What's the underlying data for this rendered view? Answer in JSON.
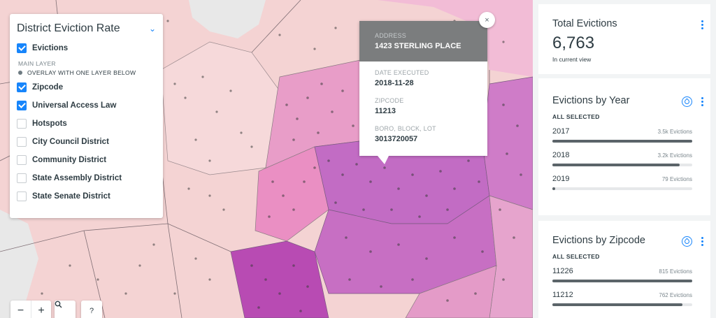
{
  "layers_panel": {
    "title": "District Eviction Rate",
    "layers": [
      {
        "label": "Evictions",
        "checked": true
      },
      {
        "label": "Zipcode",
        "checked": true
      },
      {
        "label": "Universal Access Law",
        "checked": true
      },
      {
        "label": "Hotspots",
        "checked": false
      },
      {
        "label": "City Council District",
        "checked": false
      },
      {
        "label": "Community District",
        "checked": false
      },
      {
        "label": "State Assembly District",
        "checked": false
      },
      {
        "label": "State Senate District",
        "checked": false
      }
    ],
    "main_layer_label": "MAIN LAYER",
    "overlay_label": "OVERLAY WITH ONE LAYER BELOW"
  },
  "popup": {
    "address_label": "ADDRESS",
    "address": "1423 STERLING PLACE",
    "date_label": "DATE EXECUTED",
    "date": "2018-11-28",
    "zip_label": "ZIPCODE",
    "zip": "11213",
    "bbl_label": "BORO, BLOCK, LOT",
    "bbl": "3013720057",
    "close_glyph": "×"
  },
  "map_controls": {
    "zoom_out": "−",
    "zoom_in": "+",
    "search_glyph": "🔍",
    "help": "?"
  },
  "widgets": {
    "total": {
      "title": "Total Evictions",
      "value": "6,763",
      "caption": "In current view"
    },
    "by_year": {
      "title": "Evictions by Year",
      "selection": "ALL SELECTED",
      "rows": [
        {
          "category": "2017",
          "count": "3.5k Evictions",
          "fraction": 1.0
        },
        {
          "category": "2018",
          "count": "3.2k Evictions",
          "fraction": 0.91
        },
        {
          "category": "2019",
          "count": "79 Evictions",
          "fraction": 0.02
        }
      ]
    },
    "by_zip": {
      "title": "Evictions by Zipcode",
      "selection": "ALL SELECTED",
      "rows": [
        {
          "category": "11226",
          "count": "815 Evictions",
          "fraction": 1.0
        },
        {
          "category": "11212",
          "count": "762 Evictions",
          "fraction": 0.93
        }
      ]
    }
  },
  "colors": {
    "accent": "#1785fb",
    "bar": "#5b6469",
    "map_light": "#f4d3d3",
    "map_pink": "#ea9dc7",
    "map_purple": "#c56cc0"
  }
}
